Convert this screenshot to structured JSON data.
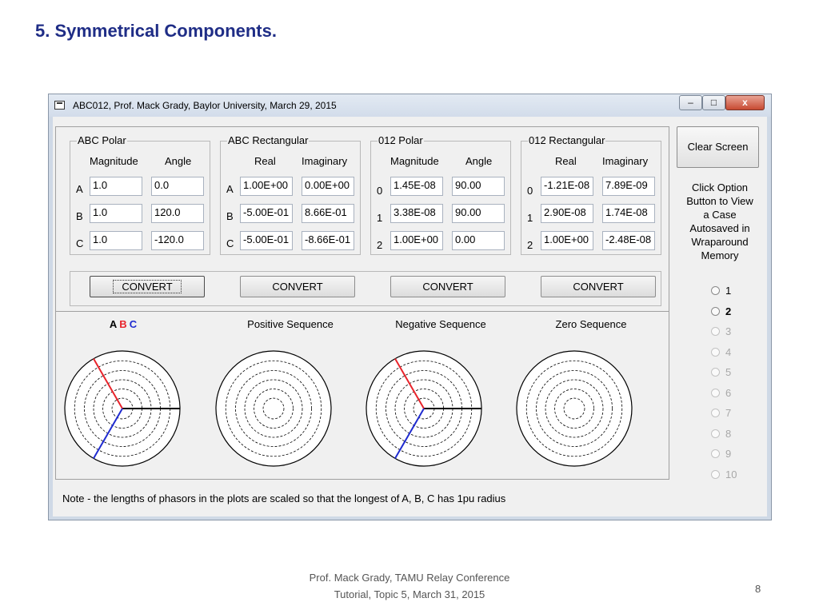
{
  "slide": {
    "title": "5. Symmetrical Components.",
    "footer_line1": "Prof. Mack Grady, TAMU Relay Conference",
    "footer_line2": "Tutorial, Topic 5, March 31, 2015",
    "page_number": "8"
  },
  "window": {
    "title": "ABC012, Prof. Mack Grady, Baylor University, March 29, 2015",
    "min_label": "–",
    "max_label": "□",
    "close_label": "x"
  },
  "abc_polar": {
    "title": "ABC Polar",
    "col1": "Magnitude",
    "col2": "Angle",
    "rows": [
      {
        "label": "A",
        "v1": "1.0",
        "v2": "0.0"
      },
      {
        "label": "B",
        "v1": "1.0",
        "v2": "120.0"
      },
      {
        "label": "C",
        "v1": "1.0",
        "v2": "-120.0"
      }
    ]
  },
  "abc_rect": {
    "title": "ABC Rectangular",
    "col1": "Real",
    "col2": "Imaginary",
    "rows": [
      {
        "label": "A",
        "v1": "1.00E+00",
        "v2": "0.00E+00"
      },
      {
        "label": "B",
        "v1": "-5.00E-01",
        "v2": "8.66E-01"
      },
      {
        "label": "C",
        "v1": "-5.00E-01",
        "v2": "-8.66E-01"
      }
    ]
  },
  "seq_polar": {
    "title": "012 Polar",
    "col1": "Magnitude",
    "col2": "Angle",
    "rows": [
      {
        "label": "0",
        "v1": "1.45E-08",
        "v2": "90.00"
      },
      {
        "label": "1",
        "v1": "3.38E-08",
        "v2": "90.00"
      },
      {
        "label": "2",
        "v1": "1.00E+00",
        "v2": "0.00"
      }
    ]
  },
  "seq_rect": {
    "title": "012 Rectangular",
    "col1": "Real",
    "col2": "Imaginary",
    "rows": [
      {
        "label": "0",
        "v1": "-1.21E-08",
        "v2": "7.89E-09"
      },
      {
        "label": "1",
        "v1": "2.90E-08",
        "v2": "1.74E-08"
      },
      {
        "label": "2",
        "v1": "1.00E+00",
        "v2": "-2.48E-08"
      }
    ]
  },
  "convert_label": "CONVERT",
  "sidebar": {
    "clear_label": "Clear Screen",
    "help_lines": [
      "Click Option",
      "Button to View",
      "a Case",
      "Autosaved in",
      "Wraparound",
      "Memory"
    ],
    "options": [
      "1",
      "2",
      "3",
      "4",
      "5",
      "6",
      "7",
      "8",
      "9",
      "10"
    ],
    "selected_option": "2",
    "enabled_options": 2
  },
  "plots": {
    "abc_letters": [
      "A",
      "B",
      "C"
    ],
    "abc_colors": [
      "#000000",
      "#e8242b",
      "#1f2bd0"
    ],
    "positive_title": "Positive Sequence",
    "negative_title": "Negative Sequence",
    "zero_title": "Zero Sequence",
    "abc_phasors": [
      {
        "angle_deg": 0,
        "magnitude": 1.0,
        "color": "#000000"
      },
      {
        "angle_deg": 120,
        "magnitude": 1.0,
        "color": "#e8242b"
      },
      {
        "angle_deg": -120,
        "magnitude": 1.0,
        "color": "#1f2bd0"
      }
    ],
    "negative_phasors": [
      {
        "angle_deg": 0,
        "magnitude": 1.0,
        "color": "#000000"
      },
      {
        "angle_deg": 120,
        "magnitude": 1.0,
        "color": "#e8242b"
      },
      {
        "angle_deg": -120,
        "magnitude": 1.0,
        "color": "#1f2bd0"
      }
    ],
    "note": "Note - the lengths of phasors in the plots are scaled so that the longest of A, B, C has 1pu radius"
  }
}
